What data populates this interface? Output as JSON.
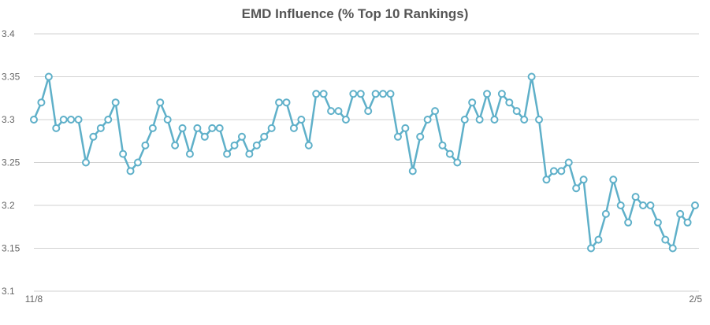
{
  "chart_data": {
    "type": "line",
    "title": "EMD Influence (% Top 10 Rankings)",
    "xlabel": "",
    "ylabel": "",
    "ylim": [
      3.1,
      3.4
    ],
    "y_ticks": [
      "3.1",
      "3.15",
      "3.2",
      "3.25",
      "3.3",
      "3.35",
      "3.4"
    ],
    "x_tick_labels": [
      {
        "index": 0,
        "label": "11/8"
      },
      {
        "index": 89,
        "label": "2/5"
      }
    ],
    "grid": true,
    "legend": "none",
    "series": [
      {
        "color": "#5fb0c9",
        "values": [
          3.3,
          3.32,
          3.35,
          3.29,
          3.3,
          3.3,
          3.3,
          3.25,
          3.28,
          3.29,
          3.3,
          3.32,
          3.26,
          3.24,
          3.25,
          3.27,
          3.29,
          3.32,
          3.3,
          3.27,
          3.29,
          3.26,
          3.29,
          3.28,
          3.29,
          3.29,
          3.26,
          3.27,
          3.28,
          3.26,
          3.27,
          3.28,
          3.29,
          3.32,
          3.32,
          3.29,
          3.3,
          3.27,
          3.33,
          3.33,
          3.31,
          3.31,
          3.3,
          3.33,
          3.33,
          3.31,
          3.33,
          3.33,
          3.33,
          3.28,
          3.29,
          3.24,
          3.28,
          3.3,
          3.31,
          3.27,
          3.26,
          3.25,
          3.3,
          3.32,
          3.3,
          3.33,
          3.3,
          3.33,
          3.32,
          3.31,
          3.3,
          3.35,
          3.3,
          3.23,
          3.24,
          3.24,
          3.25,
          3.22,
          3.23,
          3.15,
          3.16,
          3.19,
          3.23,
          3.2,
          3.18,
          3.21,
          3.2,
          3.2,
          3.18,
          3.16,
          3.15,
          3.19,
          3.18,
          3.2
        ]
      }
    ]
  }
}
